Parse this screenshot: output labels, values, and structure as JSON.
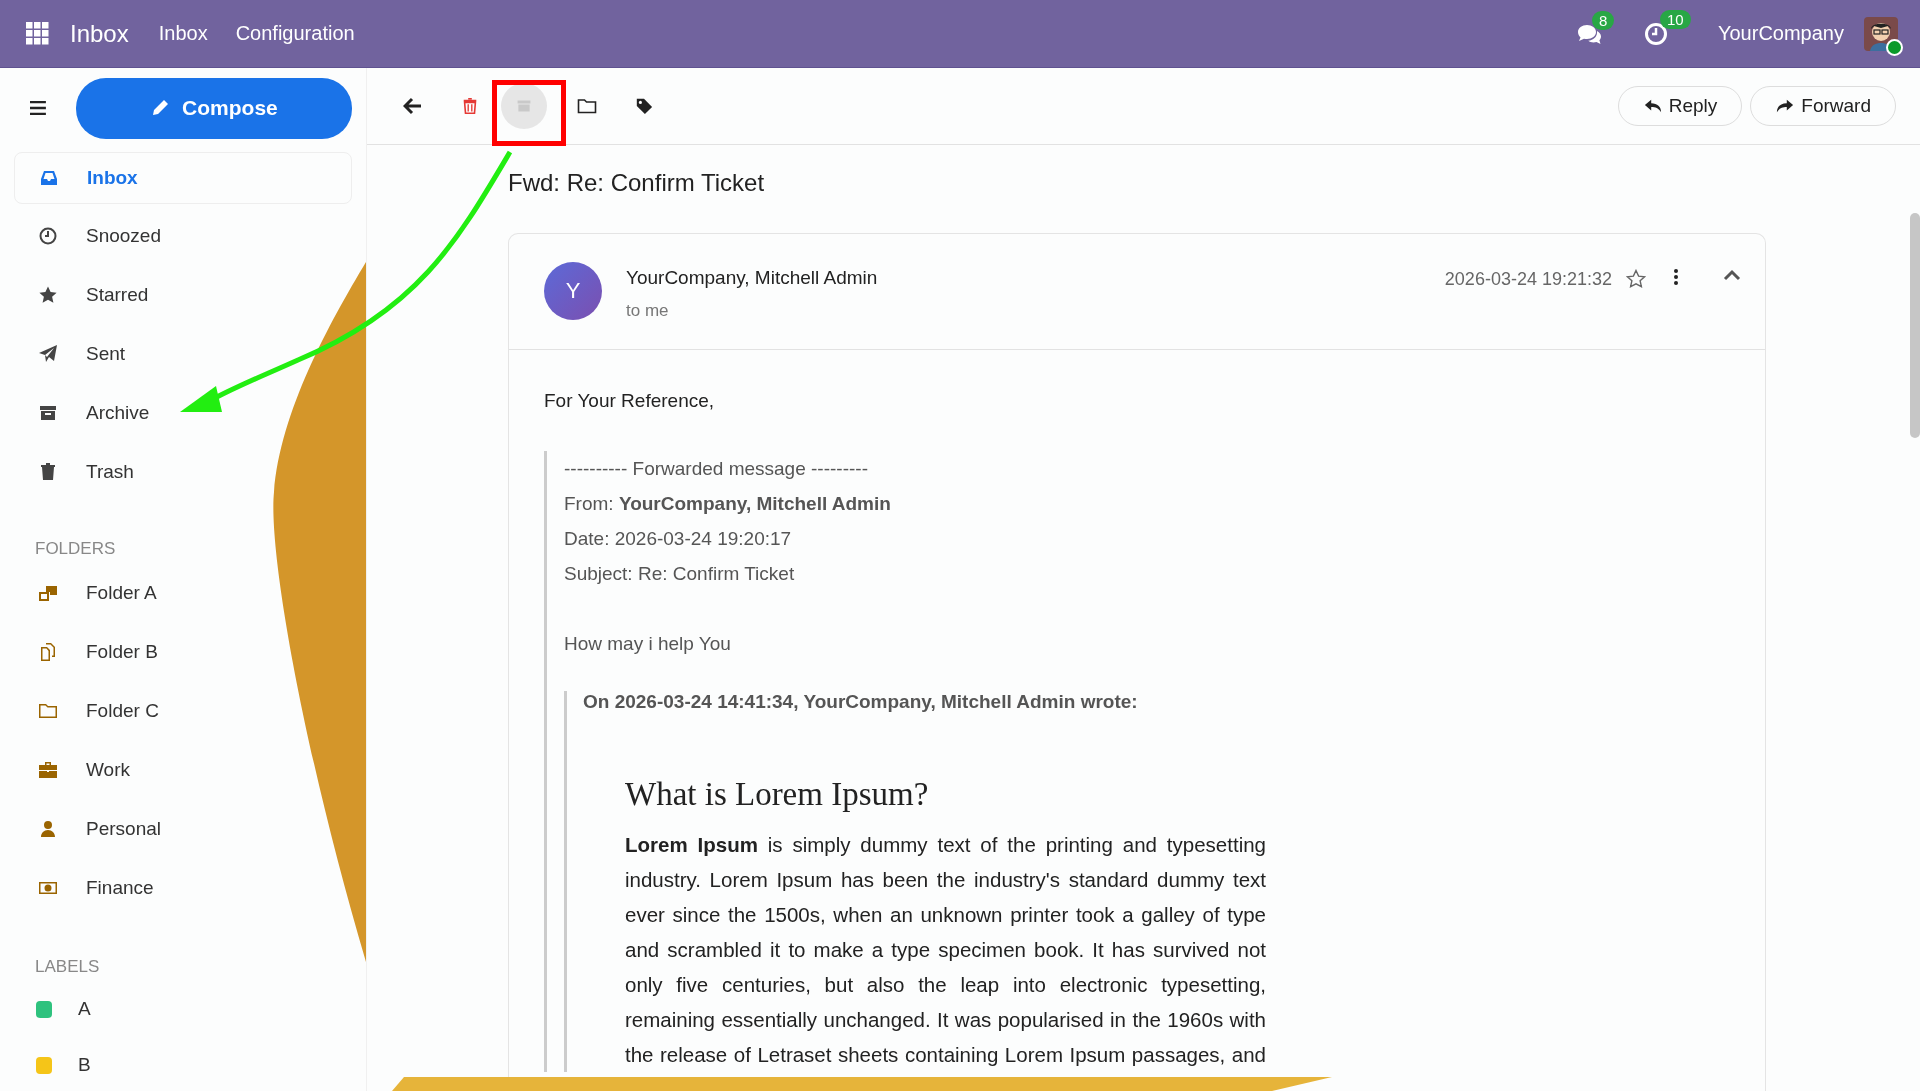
{
  "top_bar": {
    "app_name": "Inbox",
    "menu": [
      {
        "label": "Inbox"
      },
      {
        "label": "Configuration"
      }
    ],
    "messages_count": "8",
    "activities_count": "10",
    "company": "YourCompany",
    "user_online": true
  },
  "sidebar": {
    "compose_label": "Compose",
    "items": [
      {
        "label": "Inbox",
        "selected": true
      },
      {
        "label": "Snoozed",
        "selected": false
      },
      {
        "label": "Starred",
        "selected": false
      },
      {
        "label": "Sent",
        "selected": false
      },
      {
        "label": "Archive",
        "selected": false
      },
      {
        "label": "Trash",
        "selected": false
      }
    ],
    "folders_heading": "FOLDERS",
    "folders": [
      {
        "label": "Folder A"
      },
      {
        "label": "Folder B"
      },
      {
        "label": "Folder C"
      },
      {
        "label": "Work"
      },
      {
        "label": "Personal"
      },
      {
        "label": "Finance"
      }
    ],
    "labels_heading": "LABELS",
    "labels": [
      {
        "label": "A",
        "color": "#2ec27e"
      },
      {
        "label": "B",
        "color": "#f5c518"
      }
    ]
  },
  "toolbar": {
    "reply_label": "Reply",
    "forward_label": "Forward",
    "archive_hovered": true
  },
  "message": {
    "subject": "Fwd: Re: Confirm Ticket",
    "avatar_letter": "Y",
    "sender": "YourCompany, Mitchell Admin",
    "recipient": "to me",
    "date": "2026-03-24 19:21:32",
    "starred": false,
    "greeting": "For Your Reference,",
    "forwarded_lines": [
      "---------- Forwarded message ---------",
      "From: **YourCompany, Mitchell Admin**",
      "Date: 2026-03-24 19:20:17",
      "Subject: Re: Confirm Ticket"
    ],
    "reply_text": "How may i help You",
    "quote_header": "On 2026-03-24 14:41:34, YourCompany, Mitchell Admin wrote:",
    "quote_heading": "What is Lorem Ipsum?",
    "quote_paragraph": "**Lorem Ipsum** is simply dummy text of the printing and typesetting industry. Lorem Ipsum has been the industry's standard dummy text ever since the 1500s, when an unknown printer took a galley of type and scrambled it to make a type specimen book. It has survived not only five centuries, but also the leap into electronic typesetting, remaining essentially unchanged. It was popularised in the 1960s with the release of Letraset sheets containing Lorem Ipsum passages, and"
  },
  "annotations": {
    "highlight_box": true,
    "arrow": true
  }
}
